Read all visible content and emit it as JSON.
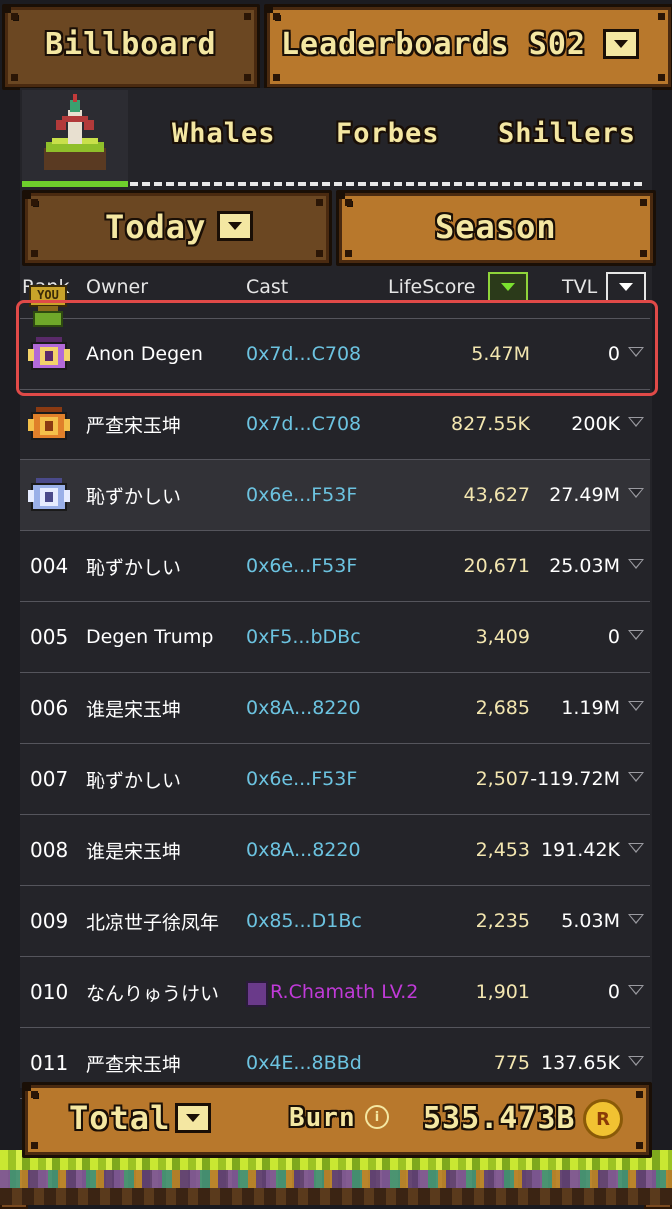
{
  "header": {
    "billboard_label": "Billboard",
    "leaderboard_label": "Leaderboards S02"
  },
  "tabs": [
    "Whales",
    "Forbes",
    "Shillers"
  ],
  "filters": {
    "today_label": "Today",
    "season_label": "Season"
  },
  "columns": {
    "rank": "Rank",
    "owner": "Owner",
    "cast": "Cast",
    "lifescore": "LifeScore",
    "tvl": "TVL"
  },
  "you_badge": "YOU",
  "rows": [
    {
      "rank": "",
      "owner": "Anon Degen",
      "cast": "0x7d...C708",
      "score": "5.47M",
      "tvl": "0",
      "badge": "purple-medal"
    },
    {
      "rank": "",
      "owner": "严查宋玉坤",
      "cast": "0x7d...C708",
      "score": "827.55K",
      "tvl": "200K",
      "badge": "gold-medal"
    },
    {
      "rank": "",
      "owner": "恥ずかしい",
      "cast": "0x6e...F53F",
      "score": "43,627",
      "tvl": "27.49M",
      "badge": "silver-medal"
    },
    {
      "rank": "004",
      "owner": "恥ずかしい",
      "cast": "0x6e...F53F",
      "score": "20,671",
      "tvl": "25.03M"
    },
    {
      "rank": "005",
      "owner": "Degen Trump",
      "cast": "0xF5...bDBc",
      "score": "3,409",
      "tvl": "0"
    },
    {
      "rank": "006",
      "owner": "谁是宋玉坤",
      "cast": "0x8A...8220",
      "score": "2,685",
      "tvl": "1.19M"
    },
    {
      "rank": "007",
      "owner": "恥ずかしい",
      "cast": "0x6e...F53F",
      "score": "2,507",
      "tvl": "-119.72M"
    },
    {
      "rank": "008",
      "owner": "谁是宋玉坤",
      "cast": "0x8A...8220",
      "score": "2,453",
      "tvl": "191.42K"
    },
    {
      "rank": "009",
      "owner": "北凉世子徐凤年",
      "cast": "0x85...D1Bc",
      "score": "2,235",
      "tvl": "5.03M"
    },
    {
      "rank": "010",
      "owner": "なんりゅうけい",
      "cast": "R.Chamath LV.2",
      "score": "1,901",
      "tvl": "0"
    },
    {
      "rank": "011",
      "owner": "严查宋玉坤",
      "cast": "0x4E...8BBd",
      "score": "775",
      "tvl": "137.65K"
    }
  ],
  "footer": {
    "total_label": "Total",
    "burn_label": "Burn",
    "burn_value": "535.473B",
    "coin_letter": "R"
  },
  "colors": {
    "accent_green": "#6fcf2c",
    "cast_link": "#6cc3e0",
    "highlight_border": "#e04a48",
    "purple_cast": "#c03ad8"
  }
}
